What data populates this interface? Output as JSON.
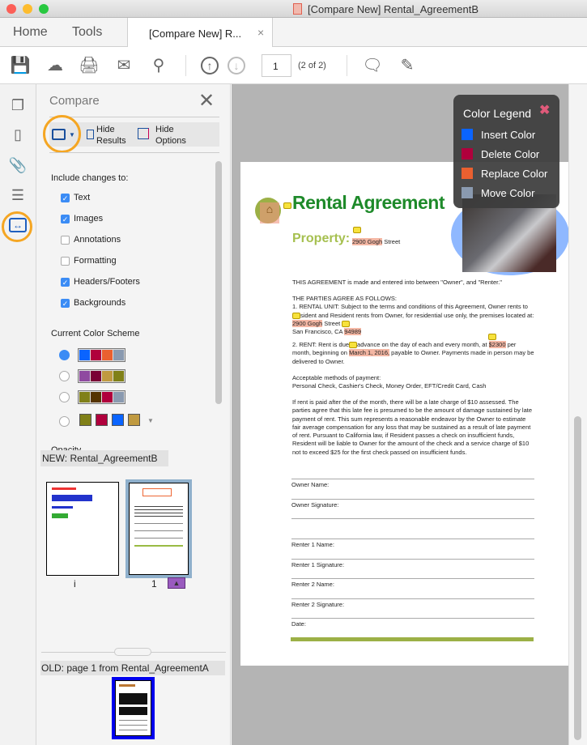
{
  "window": {
    "title": "[Compare New] Rental_AgreementB"
  },
  "tabs": {
    "home": "Home",
    "tools": "Tools",
    "doc": "[Compare New] R...",
    "close": "×"
  },
  "toolbar": {
    "page_value": "1",
    "page_count": "(2 of 2)"
  },
  "panel": {
    "title": "Compare",
    "hide_results": [
      "Hide",
      "Results"
    ],
    "hide_options": [
      "Hide",
      "Options"
    ],
    "include_label": "Include changes to:",
    "options": [
      {
        "label": "Text",
        "checked": true
      },
      {
        "label": "Images",
        "checked": true
      },
      {
        "label": "Annotations",
        "checked": false
      },
      {
        "label": "Formatting",
        "checked": false
      },
      {
        "label": "Headers/Footers",
        "checked": true
      },
      {
        "label": "Backgrounds",
        "checked": true
      }
    ],
    "scheme_label": "Current Color Scheme",
    "schemes": [
      {
        "selected": true,
        "colors": [
          "#0a64ff",
          "#b0003c",
          "#ea6030",
          "#8a9ab0"
        ]
      },
      {
        "selected": false,
        "colors": [
          "#8f4aa0",
          "#7a0035",
          "#c09a40",
          "#808018"
        ]
      },
      {
        "selected": false,
        "colors": [
          "#808018",
          "#553300",
          "#b0003c",
          "#8a9ab0"
        ]
      },
      {
        "selected": false,
        "colors": [
          "#808018",
          "#b0003c",
          "#0a64ff",
          "#c09a40"
        ]
      }
    ],
    "opacity_label": "Opacity",
    "new_label": "NEW: Rental_AgreementB",
    "new_pages": [
      "i",
      "1"
    ],
    "old_label": "OLD: page 1 from Rental_AgreementA"
  },
  "legend": {
    "title": "Color Legend",
    "items": [
      {
        "label": "Insert Color",
        "color": "#0a64ff"
      },
      {
        "label": "Delete Color",
        "color": "#b0003c"
      },
      {
        "label": "Replace Color",
        "color": "#ea6030"
      },
      {
        "label": "Move Color",
        "color": "#8a9ab0"
      }
    ]
  },
  "doc": {
    "title": "Rental Agreement",
    "property_label": "Property:",
    "property_hl": "2900 Gogh",
    "property_rest": " Street",
    "p1": "THIS AGREEMENT is made and entered into between \"Owner\", and \"Renter.\"",
    "p2a": "THE PARTIES AGREE AS FOLLOWS:",
    "p2b": "1. RENTAL UNIT: Subject to the terms and conditions of this Agreement, Owner rents to",
    "p2c": "sident and Resident rents from Owner, for residential use only, the premises located at:",
    "p2d_hl": "2900 Gogh",
    "p2d": " Street",
    "p2e": "San Francisco, CA ",
    "p2e_hl": "94989",
    "p3a": "2. RENT: Rent is due",
    "p3b": "advance on the day of each and every month, at ",
    "p3b_hl": "$2300",
    "p3c": " per",
    "p3d": "month, beginning on ",
    "p3d_hl": "March 1, 2016,",
    "p3e": " payable to Owner. Payments made in person may be",
    "p3f": "delivered to Owner.",
    "p4a": "Acceptable methods of payment:",
    "p4b": "Personal Check, Cashier's Check, Money Order, EFT/Credit Card, Cash",
    "p5": "If rent is paid after the of the month, there will be a late charge of $10 assessed. The parties agree that this late fee is presumed to be the amount of damage sustained by late payment of rent. This sum represents a reasonable endeavor by the Owner to estimate fair average compensation for any loss that may be sustained as a result of late payment of rent. Pursuant to California law, if Resident passes a check on insufficient funds, Resident will be liable to Owner for the amount of the check and a service charge of $10 not to exceed $25 for the first check passed on insufficient funds.",
    "fields": [
      "Owner Name:",
      "Owner Signature:",
      "Renter 1 Name:",
      "Renter 1 Signature:",
      "Renter 2 Name:",
      "Renter 2 Signature:",
      "Date:"
    ]
  }
}
